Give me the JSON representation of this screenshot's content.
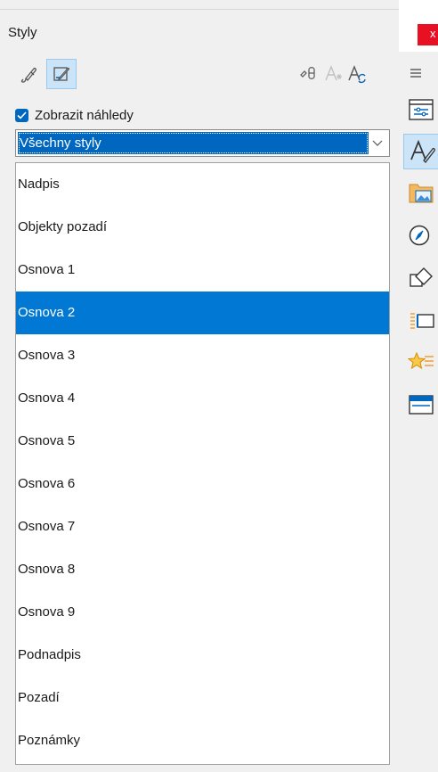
{
  "window": {
    "title": "Styly",
    "close_label": "x"
  },
  "toolbar": {
    "left_buttons": [
      {
        "icon": "fill-format-mode-icon",
        "active": false
      },
      {
        "icon": "paragraph-styles-icon",
        "active": true
      }
    ],
    "right_buttons": [
      {
        "icon": "fill-format-mode-icon"
      },
      {
        "icon": "new-style-from-selection-icon",
        "disabled": true
      },
      {
        "icon": "update-style-icon"
      }
    ]
  },
  "preview": {
    "label": "Zobrazit náhledy",
    "checked": true
  },
  "filter": {
    "value": "Všechny styly"
  },
  "styles": [
    "Nadpis",
    "Objekty pozadí",
    "Osnova 1",
    "Osnova 2",
    "Osnova 3",
    "Osnova 4",
    "Osnova 5",
    "Osnova 6",
    "Osnova 7",
    "Osnova 8",
    "Osnova 9",
    "Podnadpis",
    "Pozadí",
    "Poznámky"
  ],
  "selected_style": "Osnova 2",
  "sidebar": [
    {
      "icon": "hamburger-menu-icon"
    },
    {
      "icon": "properties-icon"
    },
    {
      "icon": "styles-icon",
      "active": true
    },
    {
      "icon": "gallery-icon"
    },
    {
      "icon": "navigator-icon"
    },
    {
      "icon": "shapes-icon"
    },
    {
      "icon": "slide-transition-icon"
    },
    {
      "icon": "animation-icon"
    },
    {
      "icon": "master-slides-icon"
    }
  ],
  "colors": {
    "accent": "#0078d4",
    "selection": "#0078d4",
    "close": "#e81123"
  }
}
